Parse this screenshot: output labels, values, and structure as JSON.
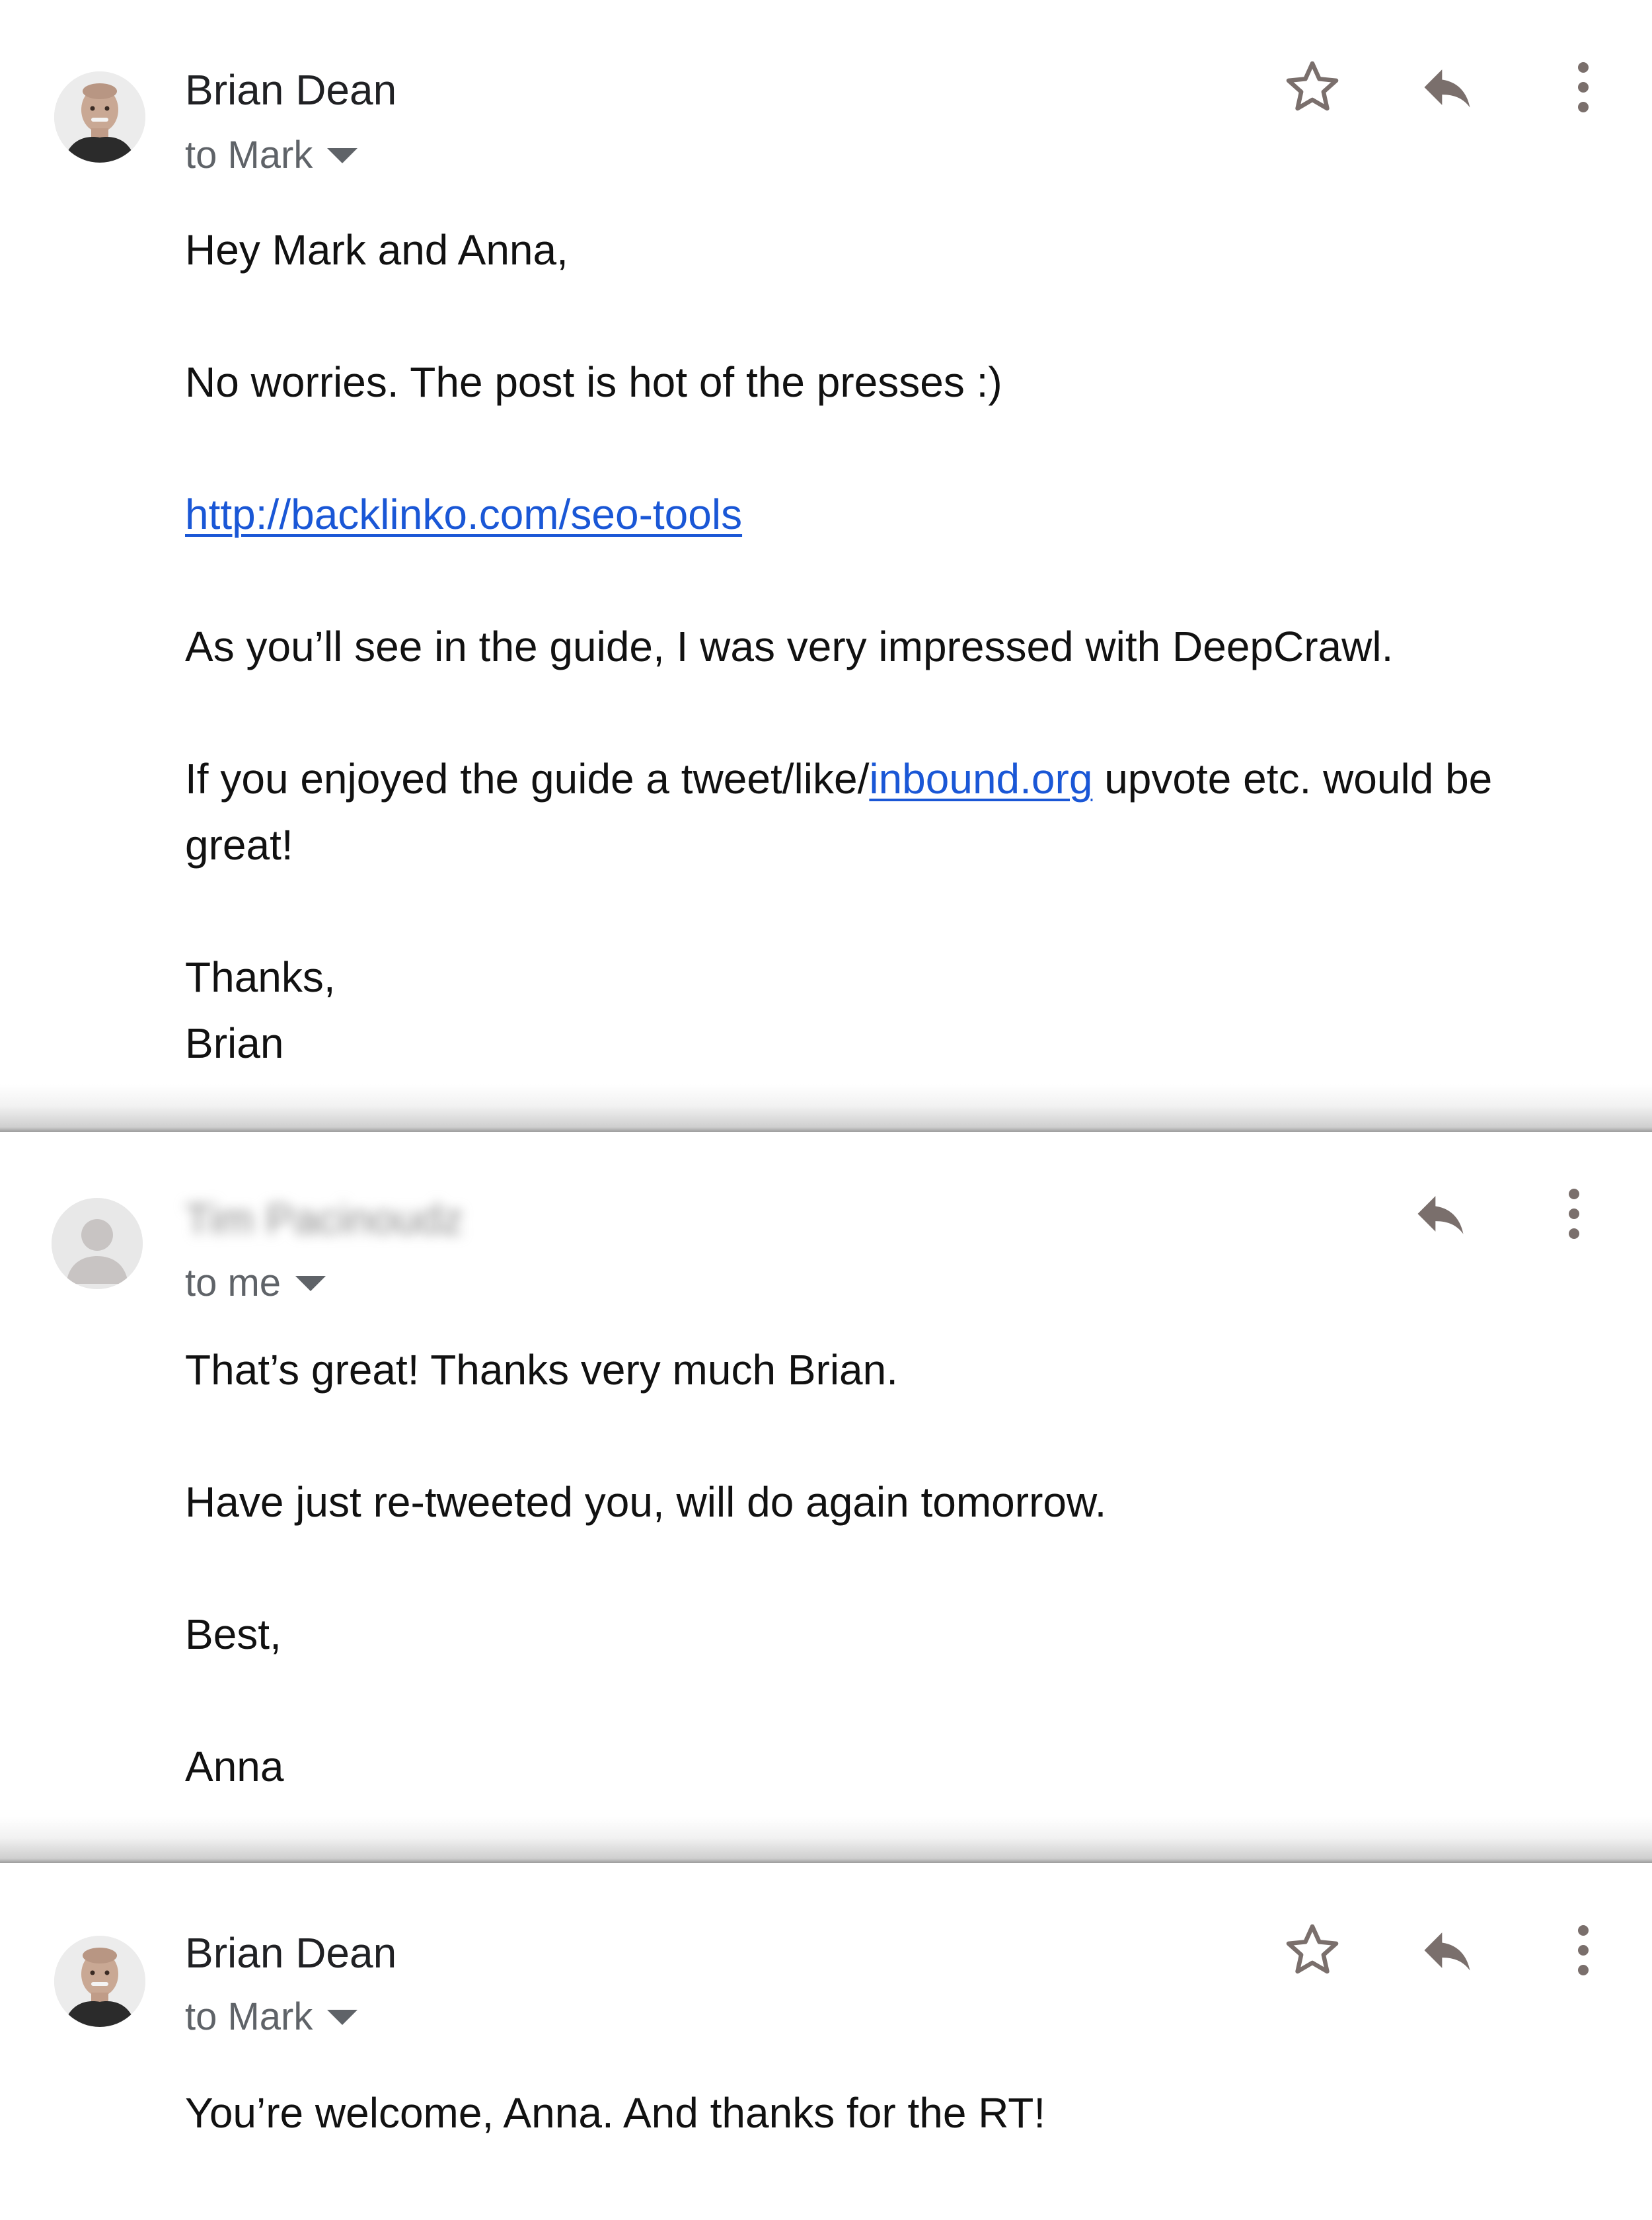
{
  "emails": [
    {
      "sender": "Brian Dean",
      "recipient": "to Mark",
      "greeting": "Hey Mark and Anna,",
      "line1": "No worries. The post is hot of the presses :)",
      "link": "http://backlinko.com/seo-tools",
      "line2": "As you’ll see in the guide, I was very impressed with DeepCrawl.",
      "line3_before": "If you enjoyed the guide a tweet/like/",
      "line3_link": "inbound.org",
      "line3_after": " upvote etc. would be",
      "line3_cont": "great!",
      "signoff": "Thanks,",
      "signature": "Brian",
      "icons": [
        "avatar-photo",
        "star-icon",
        "reply-icon",
        "more-vert-icon"
      ]
    },
    {
      "sender": "Tim Pacinoudz",
      "sender_blurred": true,
      "recipient": "to me",
      "line1": "That’s great! Thanks very much Brian.",
      "line2": "Have just re-tweeted you, will do again tomorrow.",
      "signoff": "Best,",
      "signature": "Anna",
      "icons": [
        "default-avatar-icon",
        "reply-icon",
        "more-vert-icon"
      ]
    },
    {
      "sender": "Brian Dean",
      "recipient": "to Mark",
      "line1": "You’re welcome, Anna. And thanks for the RT!",
      "icons": [
        "avatar-photo",
        "star-icon",
        "reply-icon",
        "more-vert-icon"
      ]
    }
  ],
  "colors": {
    "link": "#1a57d6",
    "icon": "#7a6f6c",
    "secondary_text": "#5f6368",
    "divider_shadow": "#9c9c9c"
  }
}
